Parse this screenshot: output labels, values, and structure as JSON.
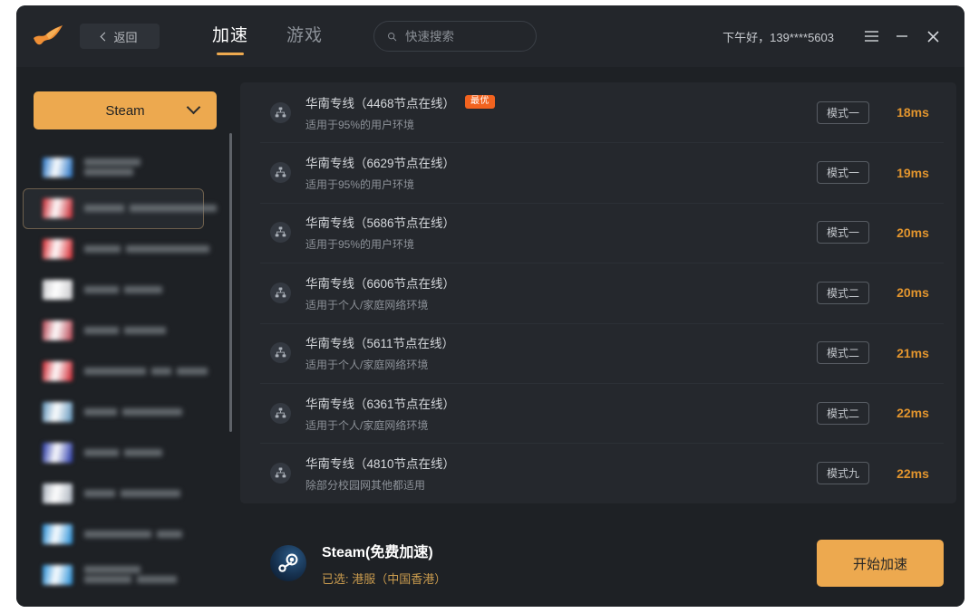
{
  "header": {
    "logo_icon": "bird-logo-icon",
    "back_label": "返回",
    "tabs": [
      {
        "label": "加速",
        "active": true
      },
      {
        "label": "游戏",
        "active": false
      }
    ],
    "search": {
      "placeholder": "快速搜索",
      "value": "",
      "icon": "search-icon"
    },
    "greeting": "下午好，139****5603",
    "window_controls": [
      {
        "name": "menu-icon",
        "glyph": "☰"
      },
      {
        "name": "minimize-icon",
        "glyph": "—"
      },
      {
        "name": "close-icon",
        "glyph": "✕"
      }
    ]
  },
  "sidebar": {
    "selector_label": "Steam",
    "selector_icon": "chevron-down-icon",
    "game_items": [
      {
        "thumb_color": "#1f6fc4",
        "redacted": [
          [
            62
          ],
          [
            54
          ]
        ],
        "selected": false
      },
      {
        "thumb_color": "#c8202a",
        "redacted": [
          [
            44,
            96
          ]
        ],
        "selected": true
      },
      {
        "thumb_color": "#d8232a",
        "redacted": [
          [
            40,
            92
          ]
        ],
        "selected": false
      },
      {
        "thumb_color": "#c9c9cc",
        "redacted": [
          [
            38,
            42
          ]
        ],
        "selected": false
      },
      {
        "thumb_color": "#b8414f",
        "redacted": [
          [
            38,
            46
          ]
        ],
        "selected": false
      },
      {
        "thumb_color": "#cf1f2a",
        "redacted": [
          [
            68,
            22,
            34
          ]
        ],
        "selected": false
      },
      {
        "thumb_color": "#5e93bb",
        "redacted": [
          [
            36,
            66
          ]
        ],
        "selected": false
      },
      {
        "thumb_color": "#2233a8",
        "redacted": [
          [
            38,
            42
          ]
        ],
        "selected": false
      },
      {
        "thumb_color": "#a8b0bb",
        "redacted": [
          [
            34,
            66
          ]
        ],
        "selected": false
      },
      {
        "thumb_color": "#1f8bd6",
        "redacted": [
          [
            74,
            28
          ]
        ],
        "selected": false
      },
      {
        "thumb_color": "#1f8bd6",
        "redacted": [
          [
            62
          ],
          [
            52,
            44
          ]
        ],
        "selected": false
      }
    ]
  },
  "main": {
    "nodes": [
      {
        "icon": "network-node-icon",
        "title": "华南专线（4468节点在线）",
        "badge": "最优",
        "sub": "适用于95%的用户环境",
        "mode": "模式一",
        "latency": "18ms"
      },
      {
        "icon": "network-node-icon",
        "title": "华南专线（6629节点在线）",
        "badge": "",
        "sub": "适用于95%的用户环境",
        "mode": "模式一",
        "latency": "19ms"
      },
      {
        "icon": "network-node-icon",
        "title": "华南专线（5686节点在线）",
        "badge": "",
        "sub": "适用于95%的用户环境",
        "mode": "模式一",
        "latency": "20ms"
      },
      {
        "icon": "network-node-icon",
        "title": "华南专线（6606节点在线）",
        "badge": "",
        "sub": "适用于个人/家庭网络环境",
        "mode": "模式二",
        "latency": "20ms"
      },
      {
        "icon": "network-node-icon",
        "title": "华南专线（5611节点在线）",
        "badge": "",
        "sub": "适用于个人/家庭网络环境",
        "mode": "模式二",
        "latency": "21ms"
      },
      {
        "icon": "network-node-icon",
        "title": "华南专线（6361节点在线）",
        "badge": "",
        "sub": "适用于个人/家庭网络环境",
        "mode": "模式二",
        "latency": "22ms"
      },
      {
        "icon": "network-node-icon",
        "title": "华南专线（4810节点在线）",
        "badge": "",
        "sub": "除部分校园网其他都适用",
        "mode": "模式九",
        "latency": "22ms"
      }
    ]
  },
  "footer": {
    "game_icon": "steam-logo-icon",
    "title": "Steam(免费加速)",
    "selection": "已选: 港服（中国香港）",
    "start_label": "开始加速"
  },
  "colors": {
    "accent": "#eda94f",
    "badge": "#f2631f",
    "latency": "#e2952e",
    "window_bg": "#1e2125",
    "header_bg": "#23262b",
    "row_bg": "#25282d"
  }
}
